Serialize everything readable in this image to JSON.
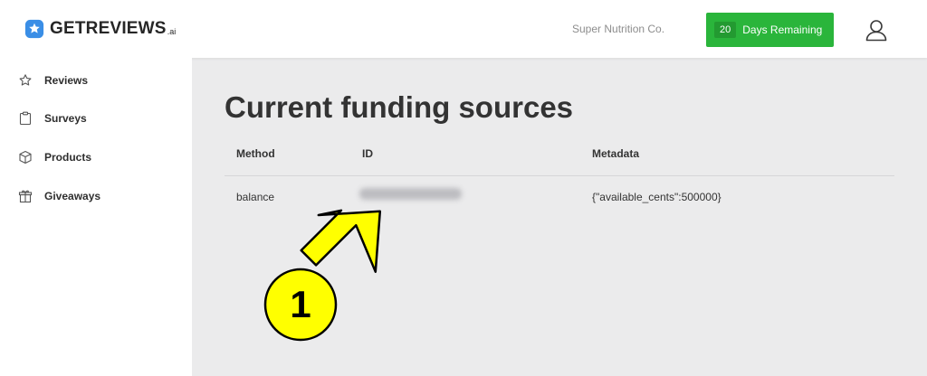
{
  "header": {
    "logo_text": "GETREVIEWS",
    "logo_suffix": ".ai",
    "company_name": "Super Nutrition Co.",
    "trial": {
      "days": "20",
      "label": "Days Remaining"
    }
  },
  "sidebar": {
    "items": [
      {
        "label": "Reviews",
        "icon": "star-icon"
      },
      {
        "label": "Surveys",
        "icon": "clipboard-icon"
      },
      {
        "label": "Products",
        "icon": "box-icon"
      },
      {
        "label": "Giveaways",
        "icon": "gift-icon"
      }
    ]
  },
  "main": {
    "title": "Current funding sources",
    "columns": [
      "Method",
      "ID",
      "Metadata"
    ],
    "rows": [
      {
        "method": "balance",
        "id": "",
        "metadata": "{\"available_cents\":500000}"
      }
    ]
  },
  "annotation": {
    "step_number": "1"
  },
  "colors": {
    "brand_blue": "#3a8ee6",
    "trial_green": "#2ab53b",
    "callout_yellow": "#ffff00"
  }
}
